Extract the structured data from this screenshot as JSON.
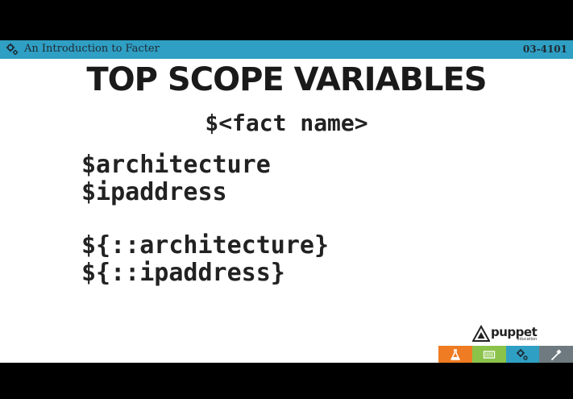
{
  "header": {
    "icon": "gear-icon",
    "title": "An Introduction to Facter",
    "code": "03-4101",
    "color": "#2f9fc4"
  },
  "slide": {
    "title": "TOP SCOPE VARIABLES",
    "subtitle": "$<fact name>",
    "code_lines": [
      "$architecture",
      "$ipaddress",
      "${::architecture}",
      "${::ipaddress}"
    ]
  },
  "logo": {
    "name": "puppet",
    "sub": "education"
  },
  "nav": {
    "buttons": [
      {
        "icon": "flask-icon",
        "color": "#ef7b22"
      },
      {
        "icon": "keyboard-icon",
        "color": "#8bc34a"
      },
      {
        "icon": "gear-icon",
        "color": "#2f9fc4"
      },
      {
        "icon": "hammer-icon",
        "color": "#6e7a80"
      }
    ]
  }
}
